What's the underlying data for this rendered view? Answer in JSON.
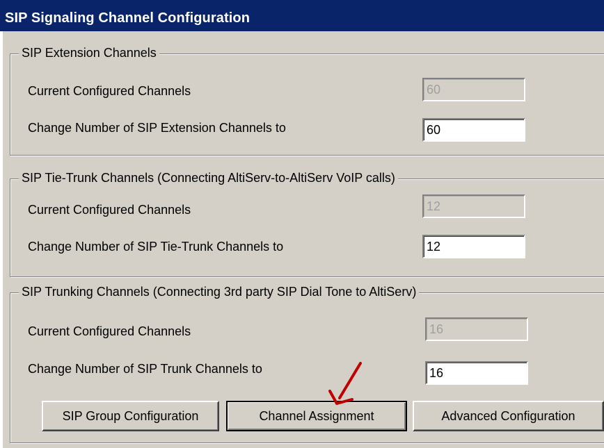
{
  "window": {
    "title": "SIP Signaling Channel Configuration"
  },
  "extension": {
    "legend": "SIP Extension Channels",
    "current_label": "Current Configured Channels",
    "current_value": "60",
    "change_label": "Change Number of SIP Extension Channels to",
    "change_value": "60"
  },
  "tie_trunk": {
    "legend": "SIP Tie-Trunk Channels (Connecting AltiServ-to-AltiServ VoIP calls)",
    "current_label": "Current Configured Channels",
    "current_value": "12",
    "change_label": "Change Number of SIP Tie-Trunk Channels to",
    "change_value": "12"
  },
  "trunking": {
    "legend": "SIP Trunking Channels (Connecting 3rd party SIP Dial Tone to AltiServ)",
    "current_label": "Current Configured Channels",
    "current_value": "16",
    "change_label": "Change Number of SIP Trunk Channels to",
    "change_value": "16"
  },
  "buttons": {
    "group_config": "SIP Group Configuration",
    "channel_assignment": "Channel Assignment",
    "advanced_config": "Advanced Configuration"
  },
  "annotation": {
    "arrow_color": "#c00000"
  }
}
